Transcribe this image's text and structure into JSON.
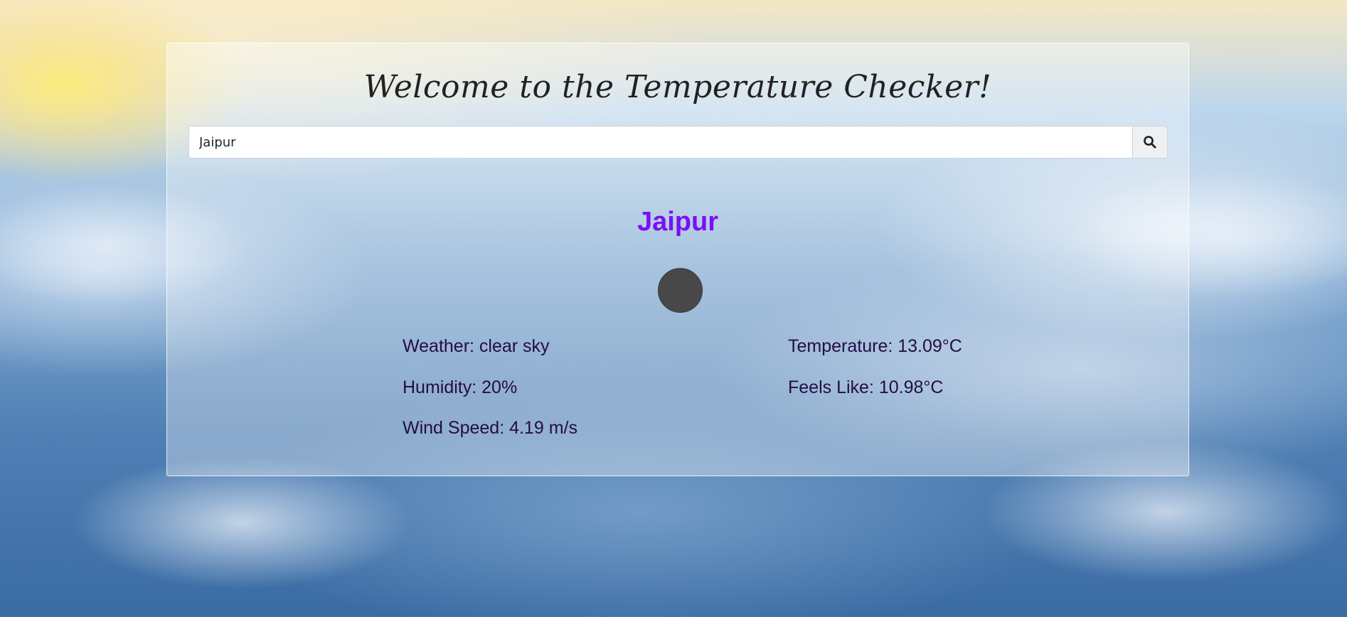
{
  "page": {
    "title": "Welcome to the Temperature Checker!"
  },
  "search": {
    "value": "Jaipur",
    "button_icon": "search-icon"
  },
  "result": {
    "city": "Jaipur",
    "weather_icon": "weather-icon",
    "weather": "Weather: clear sky",
    "temperature": "Temperature: 13.09°C",
    "humidity": "Humidity: 20%",
    "feels_like": "Feels Like: 10.98°C",
    "wind_speed": "Wind Speed: 4.19 m/s"
  },
  "colors": {
    "city": "#7a0ff5",
    "stat_text": "#230d45",
    "title_text": "#222222"
  }
}
